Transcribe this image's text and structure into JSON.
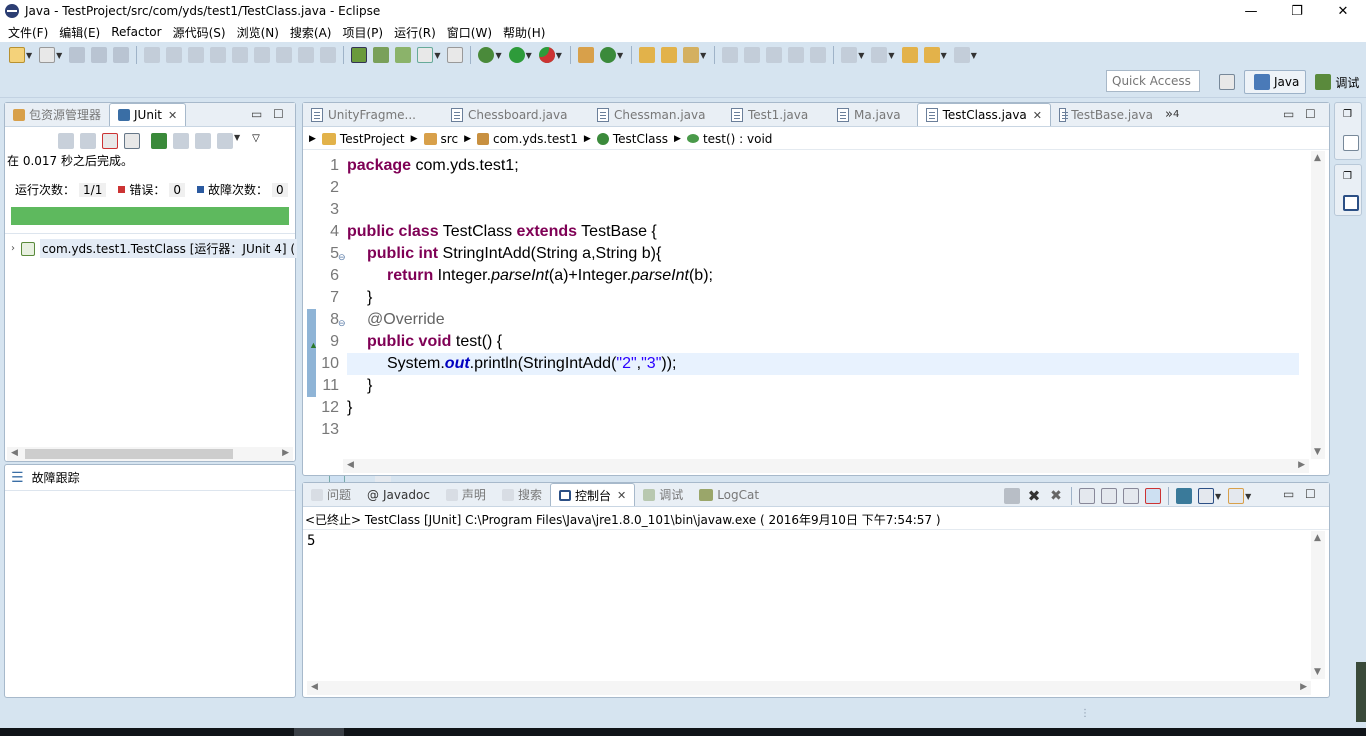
{
  "window": {
    "title": "Java  -  TestProject/src/com/yds/test1/TestClass.java  -  Eclipse",
    "min": "—",
    "max": "❐",
    "close": "✕"
  },
  "menu": [
    "文件(F)",
    "编辑(E)",
    "Refactor",
    "源代码(S)",
    "浏览(N)",
    "搜索(A)",
    "项目(P)",
    "运行(R)",
    "窗口(W)",
    "帮助(H)"
  ],
  "quick_access": {
    "placeholder": "Quick Access"
  },
  "perspectives": {
    "java": "Java",
    "debug": "调试"
  },
  "left_panel": {
    "tabs": {
      "package": "包资源管理器",
      "junit": "JUnit"
    },
    "status": "在 0.017 秒之后完成。",
    "runs_label": "运行次数：",
    "runs_value": "1/1",
    "errors_label": "错误：",
    "errors_value": "0",
    "failures_label": "故障次数：",
    "failures_value": "0",
    "progress": 1.0,
    "progress_color": "#5eb95e",
    "tree_item": "com.yds.test1.TestClass [运行器：JUnit 4] (",
    "failure_trace": "故障跟踪"
  },
  "editor": {
    "tabs": [
      "UnityFragme...",
      "Chessboard.java",
      "Chessman.java",
      "Test1.java",
      "Ma.java",
      "TestClass.java",
      "TestBase.java"
    ],
    "active_tab": 5,
    "overflow": "»",
    "overflow_count": "4",
    "breadcrumb": {
      "project": "TestProject",
      "src": "src",
      "package": "com.yds.test1",
      "class": "TestClass",
      "method": "test() : void"
    },
    "line_numbers": [
      "1",
      "2",
      "3",
      "4",
      "5",
      "6",
      "7",
      "8",
      "9",
      "10",
      "11",
      "12",
      "13"
    ],
    "code": {
      "l1_kw": "package",
      "l1_rest": " com.yds.test1;",
      "l4_kw1": "public class",
      "l4_name": " TestClass ",
      "l4_kw2": "extends",
      "l4_rest": " TestBase {",
      "l5_kw": "public int",
      "l5_sig": " StringIntAdd(String a,String b){",
      "l6_kw": "return",
      "l6_a": " Integer.",
      "l6_m1": "parseInt",
      "l6_b": "(a)+Integer.",
      "l6_m2": "parseInt",
      "l6_c": "(b);",
      "l7": "}",
      "l8": "@Override",
      "l9_kw": "public void",
      "l9_rest": " test() {",
      "l10_a": "System.",
      "l10_out": "out",
      "l10_b": ".println(StringIntAdd(",
      "l10_s1": "\"2\"",
      "l10_comma": ",",
      "l10_s2": "\"3\"",
      "l10_c": "));",
      "l11": "}",
      "l12": "}"
    }
  },
  "console": {
    "tabs": {
      "problems": "问题",
      "javadoc": "Javadoc",
      "declaration": "声明",
      "search": "搜索",
      "console": "控制台",
      "debug": "调试",
      "logcat": "LogCat"
    },
    "header": "<已终止> TestClass [JUnit] C:\\Program Files\\Java\\jre1.8.0_101\\bin\\javaw.exe ( 2016年9月10日 下午7:54:57 )",
    "output": "5"
  }
}
